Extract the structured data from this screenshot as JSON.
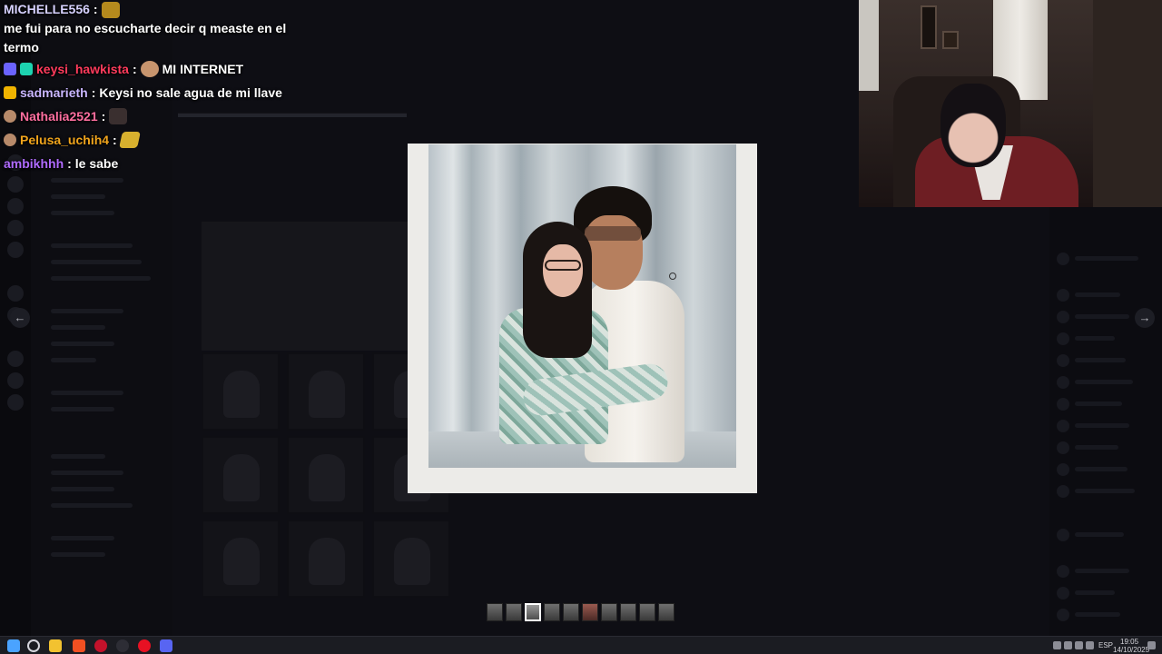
{
  "chat": {
    "messages": [
      {
        "user": "MICHELLE556",
        "user_color": "#d7d2ff",
        "text": "me fui para no escucharte decir q measte en el termo"
      },
      {
        "user": "keysi_hawkista",
        "user_color": "#ff3b5c",
        "text": "MI INTERNET"
      },
      {
        "user": "sadmarieth",
        "user_color": "#c9b6ff",
        "text": "Keysi no sale agua de mi llave"
      },
      {
        "user": "Nathalia2521",
        "user_color": "#ff6fa0",
        "text": ""
      },
      {
        "user": "Pelusa_uchih4",
        "user_color": "#f0a41c",
        "text": ""
      },
      {
        "user": "ambikhhh",
        "user_color": "#b06bff",
        "text": "le sabe"
      }
    ],
    "separator": ":"
  },
  "lightbox": {
    "prev_glyph": "←",
    "next_glyph": "→",
    "thumbnail_count": 10,
    "active_thumbnail_index": 2
  },
  "taskbar": {
    "language": "ESP",
    "time": "19:05",
    "date": "14/10/2025"
  }
}
